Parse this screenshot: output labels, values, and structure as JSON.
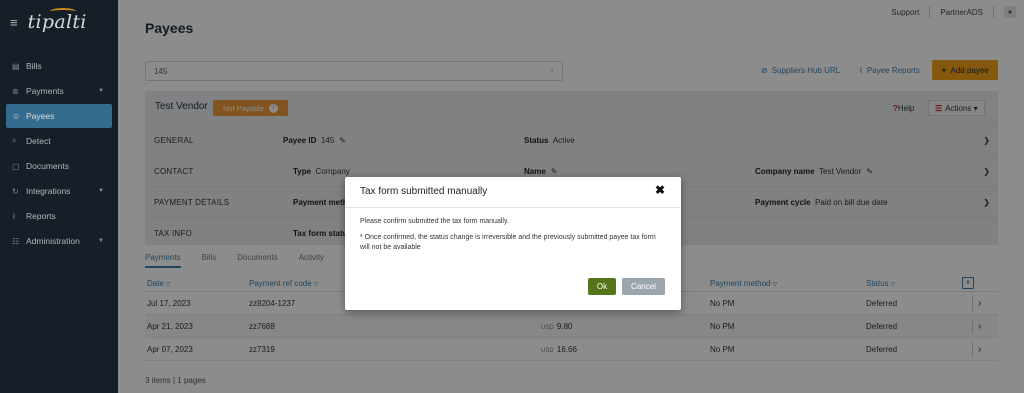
{
  "sidebar": {
    "logo": "tipalti",
    "items": [
      {
        "label": "Bills",
        "icon": "bills-icon",
        "glyph": "▤",
        "caret": false,
        "active": false
      },
      {
        "label": "Payments",
        "icon": "payments-icon",
        "glyph": "⊛",
        "caret": true,
        "active": false
      },
      {
        "label": "Payees",
        "icon": "payees-icon",
        "glyph": "☺",
        "caret": false,
        "active": true
      },
      {
        "label": "Detect",
        "icon": "detect-icon",
        "glyph": "⌕",
        "caret": false,
        "active": false
      },
      {
        "label": "Documents",
        "icon": "documents-icon",
        "glyph": "▢",
        "caret": false,
        "active": false
      },
      {
        "label": "Integrations",
        "icon": "integrations-icon",
        "glyph": "↻",
        "caret": true,
        "active": false
      },
      {
        "label": "Reports",
        "icon": "reports-icon",
        "glyph": "⌇",
        "caret": false,
        "active": false
      },
      {
        "label": "Administration",
        "icon": "administration-icon",
        "glyph": "☷",
        "caret": true,
        "active": false
      }
    ]
  },
  "topbar": {
    "support": "Support",
    "account": "PartnerADS"
  },
  "page": {
    "title": "Payees"
  },
  "search": {
    "value": "145"
  },
  "links": {
    "suppliers_hub": "Suppliers Hub URL",
    "payee_reports": "Payee Reports",
    "add_payee": "Add payee"
  },
  "payee": {
    "name": "Test Vendor",
    "status_badge": "Not Payable",
    "help": "Help",
    "actions": "Actions",
    "sections": {
      "general": {
        "label": "GENERAL",
        "payee_id_label": "Payee ID",
        "payee_id_value": "145",
        "status_label": "Status",
        "status_value": "Active"
      },
      "contact": {
        "label": "CONTACT",
        "type_label": "Type",
        "type_value": "Company",
        "name_label": "Name",
        "company_label": "Company name",
        "company_value": "Test Vendor"
      },
      "payment_details": {
        "label": "PAYMENT DETAILS",
        "method_label": "Payment metho",
        "cycle_label": "Payment cycle",
        "cycle_value": "Paid on bill due date"
      },
      "tax_info": {
        "label": "TAX INFO",
        "form_status_label": "Tax form status"
      }
    }
  },
  "tabs": [
    "Payments",
    "Bills",
    "Documents",
    "Activity"
  ],
  "table": {
    "headers": {
      "date": "Date",
      "ref": "Payment ref code",
      "method": "Payment method",
      "status": "Status"
    },
    "rows": [
      {
        "date": "Jul 17, 2023",
        "ref": "zz8204-1237",
        "currency": "",
        "amount": "",
        "method": "No PM",
        "status": "Deferred"
      },
      {
        "date": "Apr 21, 2023",
        "ref": "zz7688",
        "currency": "USD",
        "amount": "9.80",
        "method": "No PM",
        "status": "Deferred"
      },
      {
        "date": "Apr 07, 2023",
        "ref": "zz7319",
        "currency": "USD",
        "amount": "16.66",
        "method": "No PM",
        "status": "Deferred"
      }
    ],
    "footer": "3 items | 1 pages"
  },
  "modal": {
    "title": "Tax form submitted manually",
    "line1": "Please confirm submitted the tax form manually.",
    "line2": "* Once confirmed, the status change is irreversible and the previously submitted payee tax form will not be available",
    "ok": "Ok",
    "cancel": "Cancel"
  },
  "colors": {
    "sidebar_bg": "#1b2430",
    "accent": "#3d7fa8",
    "add_button": "#f0a31a",
    "not_payable_badge": "#ef9a3a",
    "ok_button": "#55751a",
    "cancel_button": "#9ca4ac"
  }
}
